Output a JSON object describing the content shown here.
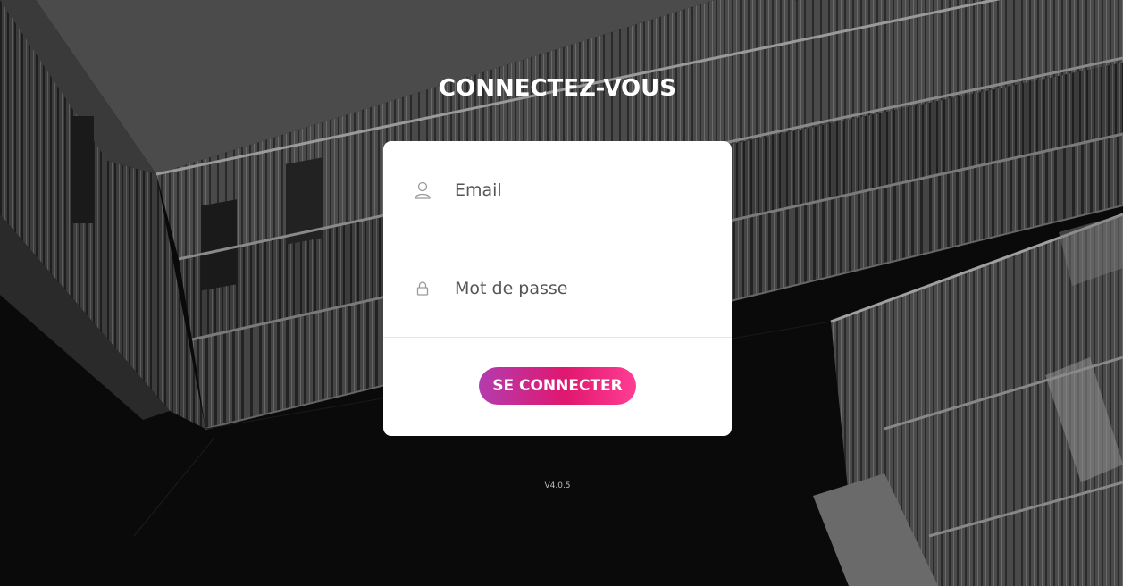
{
  "page": {
    "title": "CONNECTEZ-VOUS",
    "version": "V4.0.5"
  },
  "form": {
    "email": {
      "placeholder": "Email",
      "value": "",
      "icon": "user-icon"
    },
    "password": {
      "placeholder": "Mot de passe",
      "value": "",
      "icon": "lock-icon"
    },
    "submit_label": "SE CONNECTER"
  },
  "colors": {
    "button_gradient_start": "#b33cae",
    "button_gradient_mid": "#e0176f",
    "button_gradient_end": "#ff3e93",
    "card_background": "#ffffff",
    "page_background": "#0b0b0b"
  }
}
